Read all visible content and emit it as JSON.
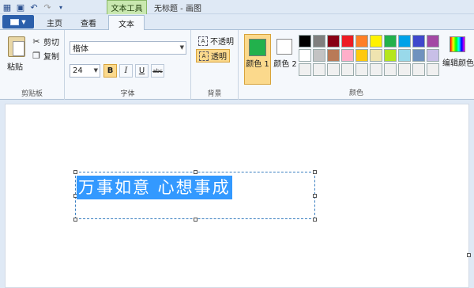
{
  "window": {
    "title": "无标题 - 画图",
    "context_tab": "文本工具"
  },
  "tabs": [
    {
      "label": "主页"
    },
    {
      "label": "查看"
    },
    {
      "label": "文本",
      "active": true
    }
  ],
  "clipboard": {
    "paste": "粘贴",
    "cut": "剪切",
    "copy": "复制",
    "group": "剪贴板"
  },
  "font": {
    "family": "楷体",
    "size": "24",
    "bold": "B",
    "italic": "I",
    "underline": "U",
    "strike": "abc",
    "group": "字体"
  },
  "background": {
    "opaque": "不透明",
    "transparent": "透明",
    "group": "背景"
  },
  "colors": {
    "color1_label": "颜色 1",
    "color2_label": "颜色 2",
    "edit_label": "编辑颜色",
    "group": "颜色",
    "color1": "#22b14c",
    "color2": "#ffffff",
    "palette_row1": [
      "#000000",
      "#7f7f7f",
      "#880015",
      "#ed1c24",
      "#ff7f27",
      "#fff200",
      "#22b14c",
      "#00a2e8",
      "#3f48cc",
      "#a349a4"
    ],
    "palette_row2": [
      "#ffffff",
      "#c3c3c3",
      "#b97a57",
      "#ffaec9",
      "#ffc90e",
      "#efe4b0",
      "#b5e61d",
      "#99d9ea",
      "#7092be",
      "#c8bfe7"
    ],
    "palette_row3": [
      "#f0f0f0",
      "#f0f0f0",
      "#f0f0f0",
      "#f0f0f0",
      "#f0f0f0",
      "#f0f0f0",
      "#f0f0f0",
      "#f0f0f0",
      "#f0f0f0",
      "#f0f0f0"
    ]
  },
  "canvas": {
    "text": "万事如意 心想事成"
  },
  "colors_accent": {
    "selection": "#3399ff",
    "active_tool": "#fbd98c"
  }
}
